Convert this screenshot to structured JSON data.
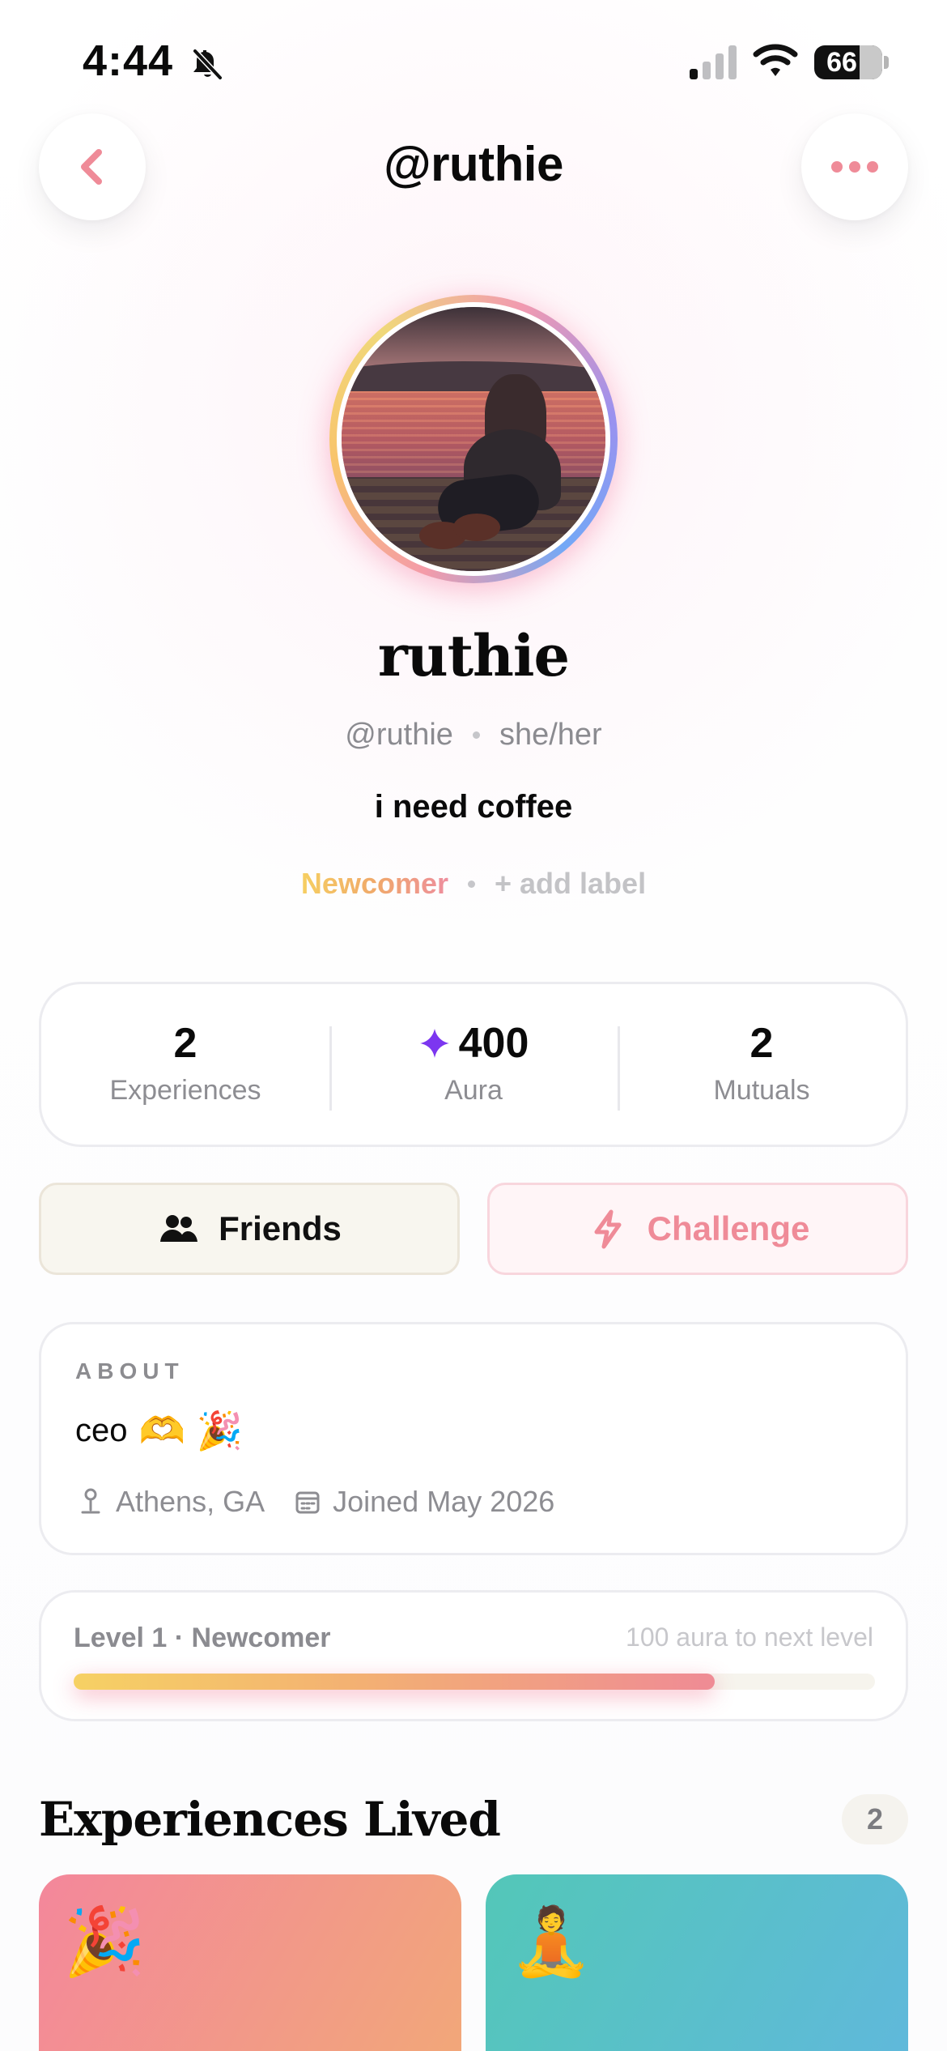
{
  "status_bar": {
    "time": "4:44",
    "battery": "66",
    "icons": [
      "bell-slash-icon",
      "cellular-signal-icon",
      "wifi-icon",
      "battery-icon"
    ]
  },
  "header": {
    "title": "@ruthie",
    "back_icon": "chevron-left-icon",
    "more_icon": "more-horizontal-icon"
  },
  "profile": {
    "display_name": "ruthie",
    "handle": "@ruthie",
    "pronouns": "she/her",
    "bio": "i need coffee",
    "badge": "Newcomer",
    "add_label": "+ add label"
  },
  "stats": [
    {
      "value": "2",
      "label": "Experiences"
    },
    {
      "value": "400",
      "label": "Aura",
      "icon": "sparkle-icon"
    },
    {
      "value": "2",
      "label": "Mutuals"
    }
  ],
  "actions": {
    "friends_label": "Friends",
    "challenge_label": "Challenge"
  },
  "about": {
    "title": "ABOUT",
    "text": "ceo",
    "emojis": [
      "🫶",
      "🎉"
    ],
    "location": "Athens, GA",
    "joined": "Joined May 2026"
  },
  "level": {
    "title": "Level 1 · Newcomer",
    "next": "100 aura to next level",
    "progress_fraction": 0.8
  },
  "experiences": {
    "title": "Experiences Lived",
    "count": "2",
    "cards": [
      {
        "emoji": "🎉"
      },
      {
        "emoji": "🧘"
      }
    ]
  },
  "colors": {
    "accent_pink": "#ef8b98",
    "accent_yellow": "#f6cf61",
    "aura_purple": "#7c36f0",
    "friends_bg": "#f8f6ef",
    "challenge_bg": "#fff5f7"
  }
}
